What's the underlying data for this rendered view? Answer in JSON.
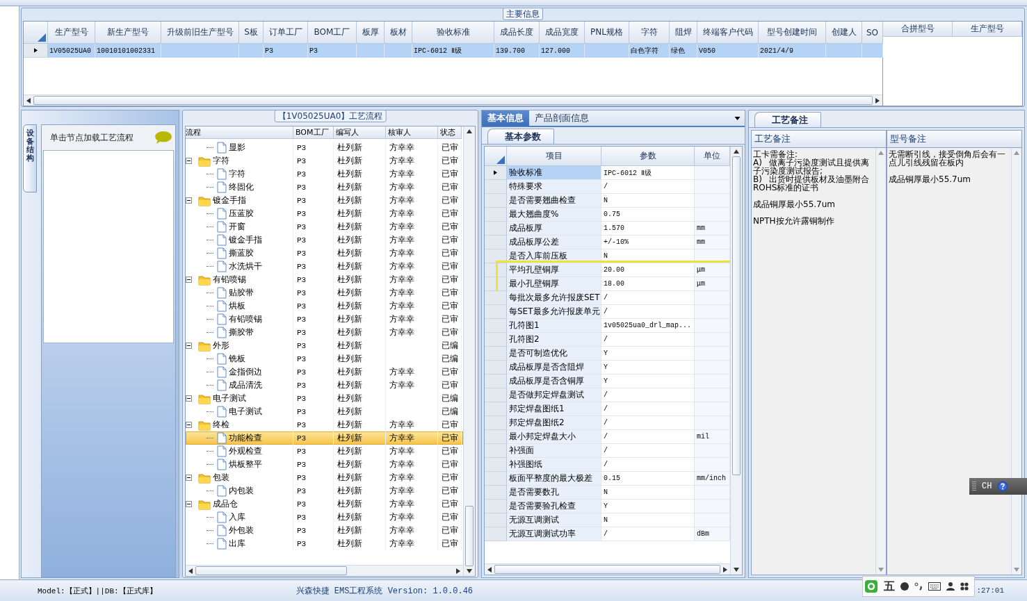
{
  "main_info": {
    "title": "主要信息",
    "columns": [
      "生产型号",
      "新生产型号",
      "升级前旧生产型号",
      "S板",
      "订单工厂",
      "BOM工厂",
      "板厚",
      "板材",
      "验收标准",
      "成品长度",
      "成品宽度",
      "PNL规格",
      "字符",
      "阻焊",
      "终端客户代码",
      "型号创建时间",
      "创建人",
      "SO"
    ],
    "rows": [
      {
        "current": true,
        "cells": [
          "1V05025UA0",
          "10010101002331",
          null,
          null,
          "P3",
          "P3",
          null,
          null,
          "IPC-6012 Ⅱ级",
          "139.700",
          "127.000",
          null,
          "白色字符",
          "绿色",
          "V050",
          "2021/4/9",
          null,
          null
        ]
      }
    ],
    "merge_columns": [
      "合拼型号",
      "生产型号"
    ]
  },
  "side": {
    "vertical_tab": "设备结构",
    "hint": "单击节点加载工艺流程"
  },
  "process_flow": {
    "title": "【1V05025UA0】工艺流程",
    "columns": [
      "流程",
      "BOM工厂",
      "编写人",
      "核审人",
      "状态"
    ],
    "nodes": [
      {
        "children": [
          {
            "kind": "step",
            "name": "显影",
            "bom": "P3",
            "writer": "杜列新",
            "reviewer": "方幸幸",
            "status": "已审",
            "selected": false
          }
        ]
      },
      {
        "kind": "folder",
        "name": "字符",
        "bom": "P3",
        "writer": "杜列新",
        "reviewer": "方幸幸",
        "status": "已审",
        "selected": false,
        "expanded": true,
        "children": [
          {
            "kind": "step",
            "name": "字符",
            "bom": "P3",
            "writer": "杜列新",
            "reviewer": "方幸幸",
            "status": "已审",
            "selected": false
          },
          {
            "kind": "step",
            "name": "终固化",
            "bom": "P3",
            "writer": "杜列新",
            "reviewer": "方幸幸",
            "status": "已审",
            "selected": false
          }
        ]
      },
      {
        "kind": "folder",
        "name": "镀金手指",
        "bom": "P3",
        "writer": "杜列新",
        "reviewer": "方幸幸",
        "status": "已审",
        "selected": false,
        "expanded": true,
        "children": [
          {
            "kind": "step",
            "name": "压蓝胶",
            "bom": "P3",
            "writer": "杜列新",
            "reviewer": "方幸幸",
            "status": "已审",
            "selected": false
          },
          {
            "kind": "step",
            "name": "开窗",
            "bom": "P3",
            "writer": "杜列新",
            "reviewer": "方幸幸",
            "status": "已审",
            "selected": false
          },
          {
            "kind": "step",
            "name": "镀金手指",
            "bom": "P3",
            "writer": "杜列新",
            "reviewer": "方幸幸",
            "status": "已审",
            "selected": false
          },
          {
            "kind": "step",
            "name": "撕蓝胶",
            "bom": "P3",
            "writer": "杜列新",
            "reviewer": "方幸幸",
            "status": "已审",
            "selected": false
          },
          {
            "kind": "step",
            "name": "水洗烘干",
            "bom": "P3",
            "writer": "杜列新",
            "reviewer": "方幸幸",
            "status": "已审",
            "selected": false
          }
        ]
      },
      {
        "kind": "folder",
        "name": "有铅喷锡",
        "bom": "P3",
        "writer": "杜列新",
        "reviewer": "方幸幸",
        "status": "已审",
        "selected": false,
        "expanded": true,
        "children": [
          {
            "kind": "step",
            "name": "贴胶带",
            "bom": "P3",
            "writer": "杜列新",
            "reviewer": "方幸幸",
            "status": "已审",
            "selected": false
          },
          {
            "kind": "step",
            "name": "烘板",
            "bom": "P3",
            "writer": "杜列新",
            "reviewer": "方幸幸",
            "status": "已审",
            "selected": false
          },
          {
            "kind": "step",
            "name": "有铅喷锡",
            "bom": "P3",
            "writer": "杜列新",
            "reviewer": "方幸幸",
            "status": "已审",
            "selected": false
          },
          {
            "kind": "step",
            "name": "撕胶带",
            "bom": "P3",
            "writer": "杜列新",
            "reviewer": "方幸幸",
            "status": "已审",
            "selected": false
          }
        ]
      },
      {
        "kind": "folder",
        "name": "外形",
        "bom": "P3",
        "writer": "杜列新",
        "status": "已编",
        "selected": false,
        "expanded": true,
        "children": [
          {
            "kind": "step",
            "name": "铣板",
            "bom": "P3",
            "writer": "杜列新",
            "status": "已编",
            "selected": false
          },
          {
            "kind": "step",
            "name": "金指倒边",
            "bom": "P3",
            "writer": "杜列新",
            "reviewer": "方幸幸",
            "status": "已审",
            "selected": false
          },
          {
            "kind": "step",
            "name": "成品清洗",
            "bom": "P3",
            "writer": "杜列新",
            "reviewer": "方幸幸",
            "status": "已审",
            "selected": false
          }
        ]
      },
      {
        "kind": "folder",
        "name": "电子测试",
        "bom": "P3",
        "writer": "杜列新",
        "status": "已编",
        "selected": false,
        "expanded": true,
        "children": [
          {
            "kind": "step",
            "name": "电子测试",
            "bom": "P3",
            "writer": "杜列新",
            "status": "已编",
            "selected": false
          }
        ]
      },
      {
        "kind": "folder",
        "name": "终检",
        "bom": "P3",
        "writer": "杜列新",
        "reviewer": "方幸幸",
        "status": "已审",
        "selected": false,
        "expanded": true,
        "children": [
          {
            "kind": "step",
            "name": "功能检查",
            "bom": "P3",
            "writer": "杜列新",
            "reviewer": "方幸幸",
            "status": "已审",
            "selected": true
          },
          {
            "kind": "step",
            "name": "外观检查",
            "bom": "P3",
            "writer": "杜列新",
            "reviewer": "方幸幸",
            "status": "已审",
            "selected": false
          },
          {
            "kind": "step",
            "name": "烘板整平",
            "bom": "P3",
            "writer": "杜列新",
            "reviewer": "方幸幸",
            "status": "已审",
            "selected": false
          }
        ]
      },
      {
        "kind": "folder",
        "name": "包装",
        "bom": "P3",
        "writer": "杜列新",
        "reviewer": "方幸幸",
        "status": "已审",
        "selected": false,
        "expanded": true,
        "children": [
          {
            "kind": "step",
            "name": "内包装",
            "bom": "P3",
            "writer": "杜列新",
            "reviewer": "方幸幸",
            "status": "已审",
            "selected": false
          }
        ]
      },
      {
        "kind": "folder",
        "name": "成品仓",
        "bom": "P3",
        "writer": "杜列新",
        "reviewer": "方幸幸",
        "status": "已审",
        "selected": false,
        "expanded": true,
        "children": [
          {
            "kind": "step",
            "name": "入库",
            "bom": "P3",
            "writer": "杜列新",
            "reviewer": "方幸幸",
            "status": "已审",
            "selected": false
          },
          {
            "kind": "step",
            "name": "外包装",
            "bom": "P3",
            "writer": "杜列新",
            "reviewer": "方幸幸",
            "status": "已审",
            "selected": false
          },
          {
            "kind": "step",
            "name": "出库",
            "bom": "P3",
            "writer": "杜列新",
            "reviewer": "方幸幸",
            "status": "已审",
            "selected": false
          }
        ]
      }
    ]
  },
  "basic_info": {
    "tabs": [
      {
        "label": "基本信息",
        "selected": true
      },
      {
        "label": "产品剖面信息",
        "selected": false
      }
    ],
    "subtab": "基本参数",
    "columns": [
      "项目",
      "参数",
      "单位"
    ],
    "rows": [
      {
        "item": "验收标准",
        "value": "IPC-6012 Ⅱ级",
        "current": true,
        "highlighted": false
      },
      {
        "item": "特殊要求",
        "value": "/",
        "current": false,
        "highlighted": false
      },
      {
        "item": "是否需要翘曲检查",
        "value": "N",
        "current": false,
        "highlighted": false
      },
      {
        "item": "最大翘曲度%",
        "value": "0.75",
        "current": false,
        "highlighted": false
      },
      {
        "item": "成品板厚",
        "value": "1.570",
        "unit": "mm",
        "current": false,
        "highlighted": false
      },
      {
        "item": "成品板厚公差",
        "value": "+/-10%",
        "unit": "mm",
        "current": false,
        "highlighted": false
      },
      {
        "item": "是否入库前压板",
        "value": "N",
        "current": false,
        "highlighted": false
      },
      {
        "item": "平均孔壁铜厚",
        "value": "20.00",
        "unit": "μm",
        "current": false,
        "highlighted": true
      },
      {
        "item": "最小孔壁铜厚",
        "value": "18.00",
        "unit": "μm",
        "current": false,
        "highlighted": true
      },
      {
        "item": "每批次最多允许报废SET",
        "value": "/",
        "current": false,
        "highlighted": false
      },
      {
        "item": "每SET最多允许报废单元",
        "value": "/",
        "current": false,
        "highlighted": false
      },
      {
        "item": "孔符图1",
        "value": "1v05025ua0_drl_map...",
        "current": false,
        "highlighted": false
      },
      {
        "item": "孔符图2",
        "value": "/",
        "current": false,
        "highlighted": false
      },
      {
        "item": "是否可制造优化",
        "value": "Y",
        "current": false,
        "highlighted": false
      },
      {
        "item": "成品板厚是否含阻焊",
        "value": "Y",
        "current": false,
        "highlighted": false
      },
      {
        "item": "成品板厚是否含铜厚",
        "value": "Y",
        "current": false,
        "highlighted": false
      },
      {
        "item": "是否做邦定焊盘测试",
        "value": "/",
        "current": false,
        "highlighted": false
      },
      {
        "item": "邦定焊盘图纸1",
        "value": "/",
        "current": false,
        "highlighted": false
      },
      {
        "item": "邦定焊盘图纸2",
        "value": "/",
        "current": false,
        "highlighted": false
      },
      {
        "item": "最小邦定焊盘大小",
        "value": "/",
        "unit": "mil",
        "current": false,
        "highlighted": false
      },
      {
        "item": "补强面",
        "value": "/",
        "current": false,
        "highlighted": false
      },
      {
        "item": "补强图纸",
        "value": "/",
        "current": false,
        "highlighted": false
      },
      {
        "item": "板面平整度的最大极差",
        "value": "0.15",
        "unit": "mm/inch",
        "current": false,
        "highlighted": false
      },
      {
        "item": "是否需要数孔",
        "value": "N",
        "current": false,
        "highlighted": false
      },
      {
        "item": "是否需要验孔检查",
        "value": "Y",
        "current": false,
        "highlighted": false
      },
      {
        "item": "无源互调测试",
        "value": "N",
        "current": false,
        "highlighted": false
      },
      {
        "item": "无源互调测试功率",
        "value": "/",
        "unit": "dBm",
        "current": false,
        "highlighted": false
      }
    ]
  },
  "notes": {
    "tab": "工艺备注",
    "columns": [
      {
        "title": "工艺备注",
        "paragraphs": [
          "工卡需备注:\nA)\t做离子污染度测试且提供离子污染度测试报告;\nB)\t出货时提供板材及油墨附合ROHS标准的证书",
          "成品铜厚最小55.7um",
          "NPTH按允许露铜制作"
        ]
      },
      {
        "title": "型号备注",
        "paragraphs": [
          "无需断引线，接受倒角后会有一点儿引线残留在板内",
          "成品铜厚最小55.7um"
        ]
      }
    ]
  },
  "language_bar": "CH",
  "status_bar": {
    "model": "Model:【正式】||DB:【正式库】",
    "app": "兴森快捷 EMS工程系统 Version: 1.0.0.46",
    "ime": "五",
    "clock": ":27:01"
  }
}
